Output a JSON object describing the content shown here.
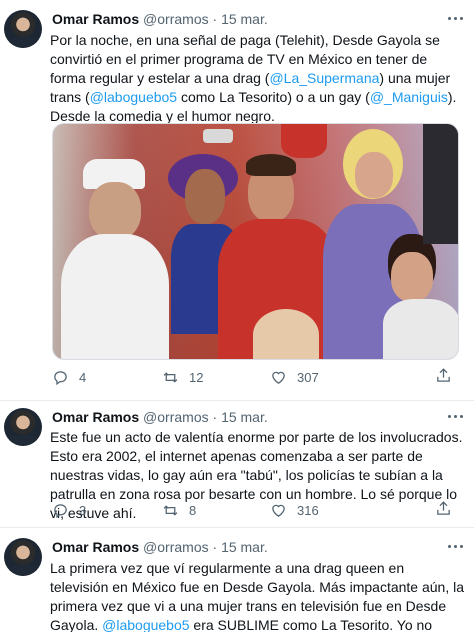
{
  "tweets": [
    {
      "author": {
        "name": "Omar Ramos",
        "handle": "@orramos",
        "date": "15 mar."
      },
      "text_parts": [
        {
          "t": "Por la noche, en una señal de paga (Telehit), Desde Gayola se convirtió en el primer programa de TV en México en tener de forma regular y estelar a una drag (",
          "m": false
        },
        {
          "t": "@La_Supermana",
          "m": true
        },
        {
          "t": ") una mujer trans (",
          "m": false
        },
        {
          "t": "@laboguebo5",
          "m": true
        },
        {
          "t": " como La Tesorito) o a un gay (",
          "m": false
        },
        {
          "t": "@_Maniguis",
          "m": true
        },
        {
          "t": "). Desde la comedia y el humor negro.",
          "m": false
        }
      ],
      "has_media": true,
      "stats": {
        "replies": "4",
        "retweets": "12",
        "likes": "307"
      }
    },
    {
      "author": {
        "name": "Omar Ramos",
        "handle": "@orramos",
        "date": "15 mar."
      },
      "text_parts": [
        {
          "t": "Este fue un acto de valentía enorme por parte de los involucrados. Esto era 2002, el internet apenas comenzaba a ser parte de nuestras vidas, lo gay aún era \"tabú\", los policías te subían a la patrulla en zona rosa por besarte con un hombre. Lo sé porque lo vi, estuve ahí.",
          "m": false
        }
      ],
      "has_media": false,
      "stats": {
        "replies": "3",
        "retweets": "8",
        "likes": "316"
      }
    },
    {
      "author": {
        "name": "Omar Ramos",
        "handle": "@orramos",
        "date": "15 mar."
      },
      "text_parts": [
        {
          "t": "La primera vez que ví regularmente a una drag queen en televisión en México fue en Desde Gayola. Más impactante aún, la primera vez que vi a una mujer trans en televisión fue en Desde Gayola. ",
          "m": false
        },
        {
          "t": "@laboguebo5",
          "m": true
        },
        {
          "t": " era SUBLIME como La Tesorito. Yo no podía creer lo que veía.",
          "m": false
        }
      ],
      "has_media": false,
      "stats": null
    }
  ],
  "icons": {
    "reply": "reply-icon",
    "retweet": "retweet-icon",
    "like": "heart-icon",
    "share": "share-icon",
    "more": "more-options-icon"
  },
  "colors": {
    "link": "#1d9bf0",
    "muted": "#536471",
    "text": "#0f1419"
  }
}
